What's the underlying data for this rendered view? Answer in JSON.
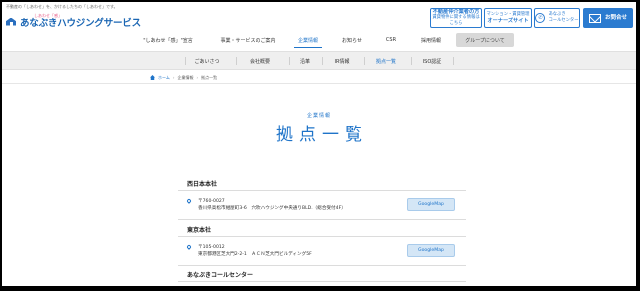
{
  "header": {
    "tagline": "不動産の「しあわせ」を、かけるしたちの「しあわせ」です。",
    "logo_sub": "しあわせ「感」",
    "logo_text": "あなぶきハウジングサービス",
    "btn_realtor": {
      "line1": "不動産仲介業者の方",
      "line2": "賃貸物件に関する情報はこちら"
    },
    "btn_owner": {
      "line1": "マンション・賃貸管理",
      "line2": "オーナーズサイト"
    },
    "btn_call": {
      "line1": "あなぶき",
      "line2": "コールセンター"
    },
    "btn_contact": "お問合せ"
  },
  "gnav": {
    "items": [
      {
        "label": "\"しあわせ「感」\"宣言"
      },
      {
        "label": "事業・サービスのご案内"
      },
      {
        "label": "企業情報"
      },
      {
        "label": "お知らせ"
      },
      {
        "label": "CSR"
      },
      {
        "label": "採用情報"
      },
      {
        "label": "グループについて"
      }
    ]
  },
  "subnav": {
    "items": [
      {
        "label": "ごあいさつ"
      },
      {
        "label": "会社概要"
      },
      {
        "label": "沿革"
      },
      {
        "label": "IR情報"
      },
      {
        "label": "拠点一覧"
      },
      {
        "label": "ISO認証"
      }
    ]
  },
  "breadcrumb": {
    "home": "ホーム",
    "parent": "企業情報",
    "current": "拠点一覧"
  },
  "page": {
    "kicker": "企業情報",
    "title": "拠点一覧"
  },
  "offices": [
    {
      "name": "西日本本社",
      "postal": "〒760-0027",
      "address": "香川県高松市紺屋町3-6　穴吹ハウジング中央通りBLD.（総合受付4F）",
      "map_label": "GoogleMap"
    },
    {
      "name": "東京本社",
      "postal": "〒105-0012",
      "address": "東京都港区芝大門2-2-1　ＡＣＮ芝大門ビルディング5F",
      "map_label": "GoogleMap"
    },
    {
      "name": "あなぶきコールセンター"
    }
  ],
  "colors": {
    "accent": "#1f74c9",
    "brand": "#1b66b3",
    "subnav_bg": "#efefef"
  }
}
